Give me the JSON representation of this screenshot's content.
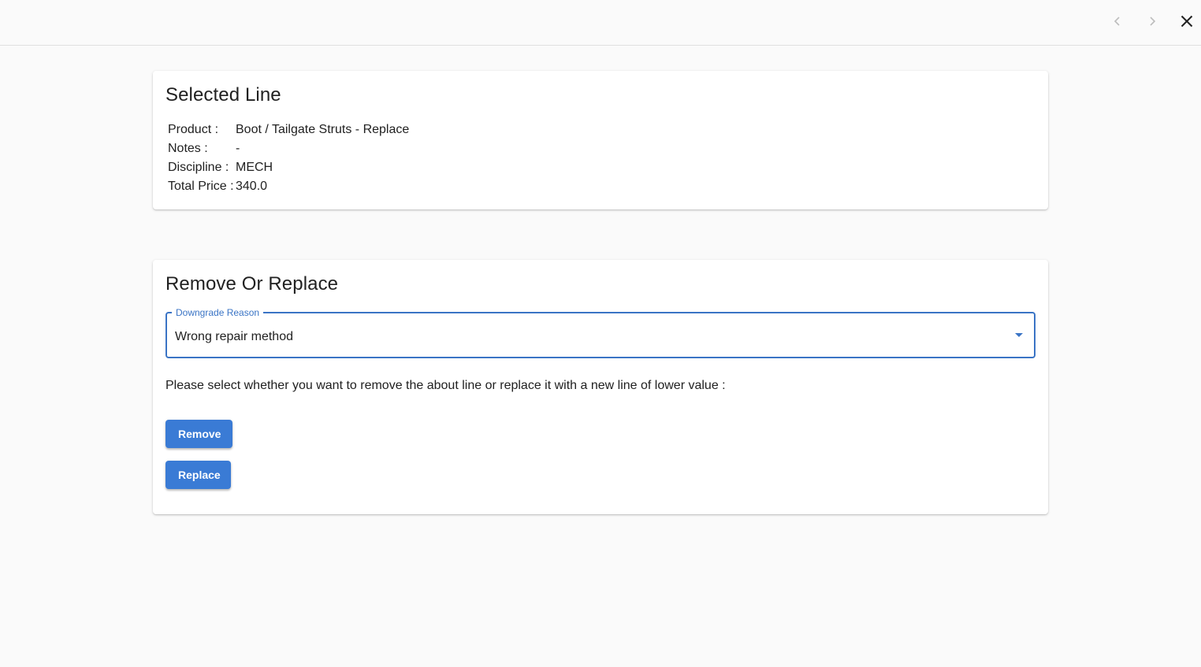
{
  "colors": {
    "accent": "#3a74c5",
    "button": "#3a7bd5",
    "background": "#fafafa"
  },
  "topbar": {
    "icons": [
      "chevron-left-icon",
      "chevron-right-icon",
      "close-icon"
    ]
  },
  "selected_line": {
    "title": "Selected Line",
    "fields": [
      {
        "label": "Product :",
        "value": "Boot / Tailgate Struts - Replace"
      },
      {
        "label": "Notes :",
        "value": "-"
      },
      {
        "label": "Discipline :",
        "value": "MECH"
      },
      {
        "label": "Total Price :",
        "value": "340.0"
      }
    ]
  },
  "remove_or_replace": {
    "title": "Remove Or Replace",
    "downgrade_reason": {
      "label": "Downgrade Reason",
      "value": "Wrong repair method"
    },
    "prompt": "Please select whether you want to remove the about line or replace it with a new line of lower value :",
    "remove_label": "Remove",
    "replace_label": "Replace"
  }
}
